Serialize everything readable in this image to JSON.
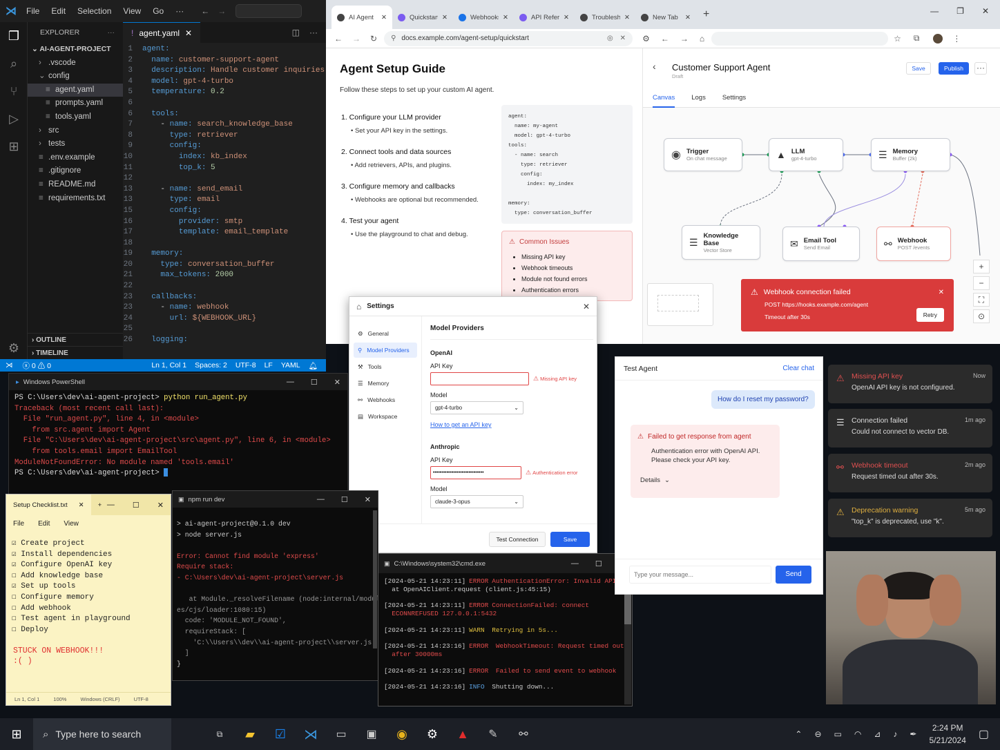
{
  "vscode": {
    "menu": [
      "File",
      "Edit",
      "Selection",
      "View",
      "Go",
      "···"
    ],
    "explorer_title": "EXPLORER",
    "project": "AI-AGENT-PROJECT",
    "tree": [
      {
        "label": ".vscode",
        "indent": 1,
        "type": "folder"
      },
      {
        "label": "config",
        "indent": 1,
        "type": "folder-open"
      },
      {
        "label": "agent.yaml",
        "indent": 2,
        "type": "file",
        "selected": true
      },
      {
        "label": "prompts.yaml",
        "indent": 2,
        "type": "file"
      },
      {
        "label": "tools.yaml",
        "indent": 2,
        "type": "file"
      },
      {
        "label": "src",
        "indent": 1,
        "type": "folder"
      },
      {
        "label": "tests",
        "indent": 1,
        "type": "folder"
      },
      {
        "label": ".env.example",
        "indent": 1,
        "type": "file"
      },
      {
        "label": ".gitignore",
        "indent": 1,
        "type": "file"
      },
      {
        "label": "README.md",
        "indent": 1,
        "type": "file"
      },
      {
        "label": "requirements.txt",
        "indent": 1,
        "type": "file"
      }
    ],
    "outline": "OUTLINE",
    "timeline": "TIMELINE",
    "tab": "agent.yaml",
    "lines": [
      {
        "n": "1",
        "parts": [
          [
            "k",
            "agent:"
          ]
        ]
      },
      {
        "n": "2",
        "parts": [
          [
            "p",
            "  "
          ],
          [
            "k",
            "name: "
          ],
          [
            "s",
            "customer-support-agent"
          ]
        ]
      },
      {
        "n": "3",
        "parts": [
          [
            "p",
            "  "
          ],
          [
            "k",
            "description: "
          ],
          [
            "s",
            "Handle customer inquiries"
          ]
        ]
      },
      {
        "n": "4",
        "parts": [
          [
            "p",
            "  "
          ],
          [
            "k",
            "model: "
          ],
          [
            "s",
            "gpt-4-turbo"
          ]
        ]
      },
      {
        "n": "5",
        "parts": [
          [
            "p",
            "  "
          ],
          [
            "k",
            "temperature: "
          ],
          [
            "n",
            "0.2"
          ]
        ]
      },
      {
        "n": "6",
        "parts": []
      },
      {
        "n": "6",
        "parts": [
          [
            "p",
            "  "
          ],
          [
            "k",
            "tools:"
          ]
        ]
      },
      {
        "n": "7",
        "parts": [
          [
            "p",
            "    - "
          ],
          [
            "k",
            "name: "
          ],
          [
            "s",
            "search_knowledge_base"
          ]
        ]
      },
      {
        "n": "8",
        "parts": [
          [
            "p",
            "      "
          ],
          [
            "k",
            "type: "
          ],
          [
            "s",
            "retriever"
          ]
        ]
      },
      {
        "n": "9",
        "parts": [
          [
            "p",
            "      "
          ],
          [
            "k",
            "config:"
          ]
        ]
      },
      {
        "n": "10",
        "parts": [
          [
            "p",
            "        "
          ],
          [
            "k",
            "index: "
          ],
          [
            "s",
            "kb_index"
          ]
        ]
      },
      {
        "n": "11",
        "parts": [
          [
            "p",
            "        "
          ],
          [
            "k",
            "top_k: "
          ],
          [
            "n",
            "5"
          ]
        ]
      },
      {
        "n": "12",
        "parts": []
      },
      {
        "n": "13",
        "parts": [
          [
            "p",
            "    - "
          ],
          [
            "k",
            "name: "
          ],
          [
            "s",
            "send_email"
          ]
        ]
      },
      {
        "n": "13",
        "parts": [
          [
            "p",
            "      "
          ],
          [
            "k",
            "type: "
          ],
          [
            "s",
            "email"
          ]
        ]
      },
      {
        "n": "15",
        "parts": [
          [
            "p",
            "      "
          ],
          [
            "k",
            "config:"
          ]
        ]
      },
      {
        "n": "16",
        "parts": [
          [
            "p",
            "        "
          ],
          [
            "k",
            "provider: "
          ],
          [
            "s",
            "smtp"
          ]
        ]
      },
      {
        "n": "17",
        "parts": [
          [
            "p",
            "        "
          ],
          [
            "k",
            "template: "
          ],
          [
            "s",
            "email_template"
          ]
        ]
      },
      {
        "n": "18",
        "parts": []
      },
      {
        "n": "19",
        "parts": [
          [
            "p",
            "  "
          ],
          [
            "k",
            "memory:"
          ]
        ]
      },
      {
        "n": "20",
        "parts": [
          [
            "p",
            "    "
          ],
          [
            "k",
            "type: "
          ],
          [
            "s",
            "conversation_buffer"
          ]
        ]
      },
      {
        "n": "21",
        "parts": [
          [
            "p",
            "    "
          ],
          [
            "k",
            "max_tokens: "
          ],
          [
            "n",
            "2000"
          ]
        ]
      },
      {
        "n": "22",
        "parts": []
      },
      {
        "n": "23",
        "parts": [
          [
            "p",
            "  "
          ],
          [
            "k",
            "callbacks:"
          ]
        ]
      },
      {
        "n": "23",
        "parts": [
          [
            "p",
            "    - "
          ],
          [
            "k",
            "name: "
          ],
          [
            "s",
            "webhook"
          ]
        ]
      },
      {
        "n": "24",
        "parts": [
          [
            "p",
            "      "
          ],
          [
            "k",
            "url: "
          ],
          [
            "s",
            "${WEBHOOK_URL}"
          ]
        ]
      },
      {
        "n": "25",
        "parts": []
      },
      {
        "n": "26",
        "parts": [
          [
            "p",
            "  "
          ],
          [
            "k",
            "logging:"
          ]
        ]
      }
    ],
    "status": {
      "errors": "0",
      "warnings": "0",
      "pos": "Ln 1, Col 1",
      "spaces": "Spaces: 2",
      "enc": "UTF-8",
      "eol": "LF",
      "lang": "YAML"
    }
  },
  "browser": {
    "tabs": [
      {
        "label": "AI Agent",
        "color": "#444"
      },
      {
        "label": "Quickstart",
        "color": "#7b5cf0"
      },
      {
        "label": "Webhooks",
        "color": "#1a73e8"
      },
      {
        "label": "API Reference",
        "color": "#7b5cf0"
      },
      {
        "label": "Troubleshooting",
        "color": "#444"
      },
      {
        "label": "New Tab",
        "color": "#444"
      }
    ],
    "url": "docs.example.com/agent-setup/quickstart",
    "doc": {
      "title": "Agent Setup Guide",
      "subtitle": "Follow these steps to set up your custom AI agent.",
      "steps": [
        {
          "h": "1.  Configure your LLM provider",
          "b": "Set your API key in the settings."
        },
        {
          "h": "2.  Connect tools and data sources",
          "b": "Add retrievers, APIs, and plugins."
        },
        {
          "h": "3.  Configure memory and callbacks",
          "b": "Webhooks are optional but recommended."
        },
        {
          "h": "4.  Test your agent",
          "b": "Use the playground to chat and debug."
        }
      ],
      "code": [
        "agent:",
        "  name: my-agent",
        "  model: gpt-4-turbo",
        "tools:",
        "  - name: search",
        "    type: retriever",
        "    config:",
        "      index: my_index",
        "",
        "memory:",
        "  type: conversation_buffer"
      ],
      "issues_title": "Common Issues",
      "issues": [
        "Missing API key",
        "Webhook timeouts",
        "Module not found errors",
        "Authentication errors"
      ]
    },
    "builder": {
      "title": "Customer Support Agent",
      "draft": "Draft",
      "save": "Save",
      "publish": "Publish",
      "tabs": [
        "Canvas",
        "Logs",
        "Settings"
      ],
      "nodes": {
        "trigger": {
          "t": "Trigger",
          "s": "On chat message"
        },
        "llm": {
          "t": "LLM",
          "s": "gpt-4-turbo"
        },
        "memory": {
          "t": "Memory",
          "s": "Buffer (2k)"
        },
        "kb": {
          "t": "Knowledge Base",
          "s": "Vector Store"
        },
        "email": {
          "t": "Email Tool",
          "s": "Send Email"
        },
        "webhook": {
          "t": "Webhook",
          "s": "POST /events"
        }
      },
      "error": {
        "title": "Webhook connection failed",
        "line1": "POST https://hooks.example.com/agent",
        "line2": "Timeout after 30s",
        "retry": "Retry"
      }
    }
  },
  "powershell": {
    "title": "Windows PowerShell",
    "lines": [
      {
        "c": "#ddd",
        "t": "PS C:\\Users\\dev\\ai-agent-project> ",
        "t2": "python run_agent.py",
        "c2": "#f5e56b"
      },
      {
        "c": "#e04b4b",
        "t": "Traceback (most recent call last):"
      },
      {
        "c": "#e04b4b",
        "t": "  File \"run_agent.py\", line 4, in <module>"
      },
      {
        "c": "#e04b4b",
        "t": "    from src.agent import Agent"
      },
      {
        "c": "#e04b4b",
        "t": "  File \"C:\\Users\\dev\\ai-agent-project\\src\\agent.py\", line 6, in <module>"
      },
      {
        "c": "#e04b4b",
        "t": "    from tools.email import EmailTool"
      },
      {
        "c": "#e04b4b",
        "t": "ModuleNotFoundError: No module named 'tools.email'"
      },
      {
        "c": "#ddd",
        "t": "PS C:\\Users\\dev\\ai-agent-project> "
      }
    ]
  },
  "settings": {
    "title": "Settings",
    "nav": [
      "General",
      "Model Providers",
      "Tools",
      "Memory",
      "Webhooks",
      "Workspace"
    ],
    "section": "Model Providers",
    "openai": {
      "h": "OpenAI",
      "key_label": "API Key",
      "key_value": "",
      "key_error": "Missing API key",
      "model_label": "Model",
      "model": "gpt-4-turbo",
      "link": "How to get an API key"
    },
    "anthropic": {
      "h": "Anthropic",
      "key_label": "API Key",
      "key_value": "••••••••••••••••••••••••••••••",
      "key_error": "Authentication error",
      "model_label": "Model",
      "model": "claude-3-opus"
    },
    "test": "Test Connection",
    "save": "Save"
  },
  "notepad": {
    "title": "Setup Checklist.txt",
    "menu": [
      "File",
      "Edit",
      "View"
    ],
    "items": [
      {
        "t": "Create project",
        "done": true
      },
      {
        "t": "Install dependencies",
        "done": true
      },
      {
        "t": "Configure OpenAI key",
        "done": true
      },
      {
        "t": "Add knowledge base",
        "done": false
      },
      {
        "t": "Set up tools",
        "done": true
      },
      {
        "t": "Configure memory",
        "done": false
      },
      {
        "t": "Add webhook",
        "done": false
      },
      {
        "t": "Test agent in playground",
        "done": false
      },
      {
        "t": "Deploy",
        "done": false
      }
    ],
    "note1": "STUCK ON WEBHOOK!!!",
    "note2": ":( )",
    "status": [
      "Ln 1, Col 1",
      "100%",
      "Windows (CRLF)",
      "UTF-8"
    ]
  },
  "npm": {
    "title": "npm run dev",
    "lines": [
      {
        "c": "#ccc",
        "t": "> ai-agent-project@0.1.0 dev"
      },
      {
        "c": "#ccc",
        "t": "> node server.js"
      },
      {
        "c": "#ccc",
        "t": ""
      },
      {
        "c": "#e04b4b",
        "t": "Error: Cannot find module 'express'"
      },
      {
        "c": "#e04b4b",
        "t": "Require stack:"
      },
      {
        "c": "#e04b4b",
        "t": "- C:\\Users\\dev\\ai-agent-project\\server.js"
      },
      {
        "c": "#ccc",
        "t": ""
      },
      {
        "c": "#999",
        "t": "   at Module._resolveFilename (node:internal/modul"
      },
      {
        "c": "#999",
        "t": "es/cjs/loader:1080:15)"
      },
      {
        "c": "#999",
        "t": "  code: 'MODULE_NOT_FOUND',"
      },
      {
        "c": "#999",
        "t": "  requireStack: ["
      },
      {
        "c": "#999",
        "t": "    'C:\\\\Users\\\\dev\\\\ai-agent-project\\\\server.js'"
      },
      {
        "c": "#999",
        "t": "  ]"
      },
      {
        "c": "#ccc",
        "t": "}"
      },
      {
        "c": "#ccc",
        "t": ""
      },
      {
        "c": "#ccc",
        "t": "Node.js v18.19.0"
      }
    ]
  },
  "cmd": {
    "title": "C:\\Windows\\system32\\cmd.exe",
    "lines": [
      {
        "ts": "[2024-05-21 14:23:11]",
        "lvl": "ERROR",
        "lc": "#e04b4b",
        "msg": "AuthenticationError: Invalid API key",
        "mc": "#e04b4b"
      },
      {
        "ts": "",
        "lvl": "",
        "lc": "#ccc",
        "msg": "  at OpenAIClient.request (client.js:45:15)",
        "mc": "#ccc"
      },
      {
        "ts": "",
        "lvl": "",
        "lc": "#ccc",
        "msg": "",
        "mc": "#ccc"
      },
      {
        "ts": "[2024-05-21 14:23:11]",
        "lvl": "ERROR",
        "lc": "#e04b4b",
        "msg": "ConnectionFailed: connect",
        "mc": "#e04b4b"
      },
      {
        "ts": "",
        "lvl": "",
        "lc": "#ccc",
        "msg": "  ECONNREFUSED 127.0.0.1:5432",
        "mc": "#e04b4b"
      },
      {
        "ts": "",
        "lvl": "",
        "lc": "#ccc",
        "msg": "",
        "mc": "#ccc"
      },
      {
        "ts": "[2024-05-21 14:23:11]",
        "lvl": "WARN",
        "lc": "#e0c040",
        "msg": " Retrying in 5s...",
        "mc": "#e0c040"
      },
      {
        "ts": "",
        "lvl": "",
        "lc": "#ccc",
        "msg": "",
        "mc": "#ccc"
      },
      {
        "ts": "[2024-05-21 14:23:16]",
        "lvl": "ERROR",
        "lc": "#e04b4b",
        "msg": " WebhookTimeout: Request timed out",
        "mc": "#e04b4b"
      },
      {
        "ts": "",
        "lvl": "",
        "lc": "#ccc",
        "msg": "  after 30000ms",
        "mc": "#e04b4b"
      },
      {
        "ts": "",
        "lvl": "",
        "lc": "#ccc",
        "msg": "",
        "mc": "#ccc"
      },
      {
        "ts": "[2024-05-21 14:23:16]",
        "lvl": "ERROR",
        "lc": "#e04b4b",
        "msg": " Failed to send event to webhook",
        "mc": "#e04b4b"
      },
      {
        "ts": "",
        "lvl": "",
        "lc": "#ccc",
        "msg": "",
        "mc": "#ccc"
      },
      {
        "ts": "[2024-05-21 14:23:16]",
        "lvl": "INFO",
        "lc": "#5aa0e0",
        "msg": " Shutting down...",
        "mc": "#ccc"
      }
    ]
  },
  "test_agent": {
    "title": "Test Agent",
    "clear": "Clear chat",
    "user_msg": "How do I reset my password?",
    "err_title": "Failed to get response from agent",
    "err_body1": "Authentication error with OpenAI API.",
    "err_body2": "Please check your API key.",
    "details": "Details",
    "placeholder": "Type your message...",
    "send": "Send"
  },
  "notifications": [
    {
      "title": "Missing API key",
      "time": "Now",
      "body": "OpenAI API key is not configured.",
      "color": "#e05050",
      "icon": "warning-icon"
    },
    {
      "title": "Connection failed",
      "time": "1m ago",
      "body": "Could not connect to vector DB.",
      "color": "#dddddd",
      "icon": "database-icon"
    },
    {
      "title": "Webhook timeout",
      "time": "2m ago",
      "body": "Request timed out after 30s.",
      "color": "#e05050",
      "icon": "webhook-icon"
    },
    {
      "title": "Deprecation warning",
      "time": "5m ago",
      "body": "\"top_k\" is deprecated, use \"k\".",
      "color": "#e0b040",
      "icon": "warning-icon"
    }
  ],
  "taskbar": {
    "search": "Type here to search",
    "time": "2:24 PM",
    "date": "5/21/2024"
  }
}
